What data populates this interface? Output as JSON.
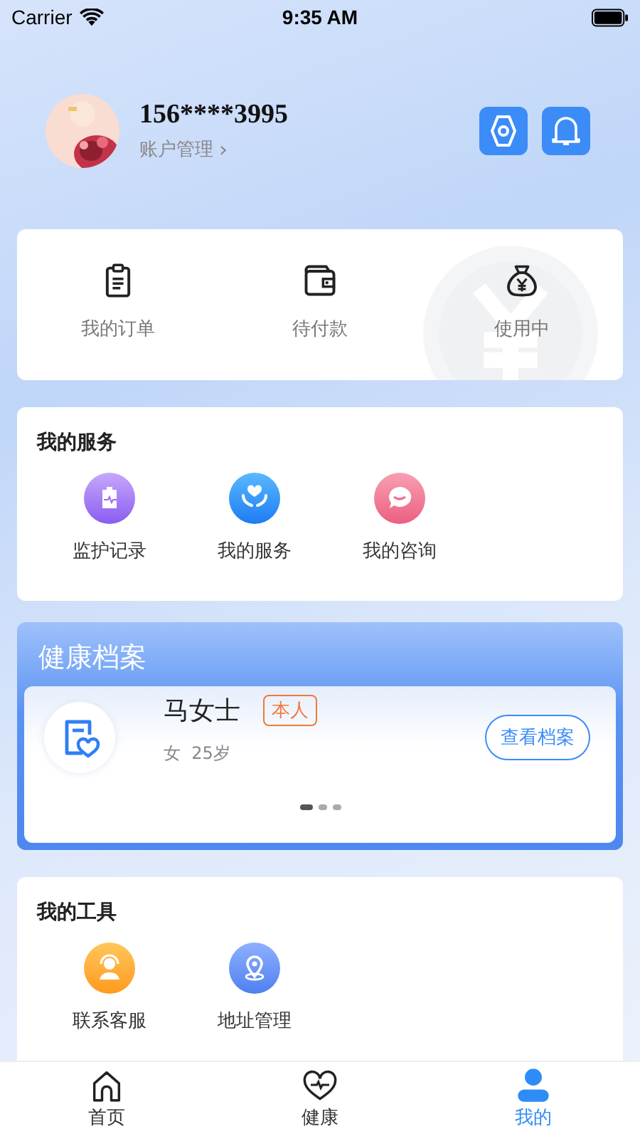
{
  "status_bar": {
    "carrier": "Carrier",
    "time": "9:35 AM"
  },
  "profile": {
    "phone": "156****3995",
    "account_link": "账户管理",
    "chevron": "›"
  },
  "header_buttons": [
    {
      "kind": "settings"
    },
    {
      "kind": "bell"
    }
  ],
  "orders": [
    {
      "kind": "clipboard",
      "label": "我的订单"
    },
    {
      "kind": "wallet",
      "label": "待付款"
    },
    {
      "kind": "moneybag",
      "label": "使用中"
    }
  ],
  "services": {
    "title": "我的服务",
    "items": [
      {
        "kind": "record",
        "label": "监护记录"
      },
      {
        "kind": "care",
        "label": "我的服务"
      },
      {
        "kind": "chat",
        "label": "我的咨询"
      }
    ]
  },
  "health_record": {
    "title": "健康档案",
    "name": "马女士",
    "tag": "本人",
    "info": "女  25岁",
    "button": "查看档案",
    "pages": [
      {
        "selected": true
      },
      {
        "selected": false
      },
      {
        "selected": false
      }
    ]
  },
  "tools": {
    "title": "我的工具",
    "items": [
      {
        "kind": "support",
        "label": "联系客服"
      },
      {
        "kind": "location",
        "label": "地址管理"
      }
    ]
  },
  "tab_bar": [
    {
      "kind": "home",
      "label": "首页",
      "selected": false
    },
    {
      "kind": "heart",
      "label": "健康",
      "selected": false
    },
    {
      "kind": "person",
      "label": "我的",
      "selected": true
    }
  ]
}
